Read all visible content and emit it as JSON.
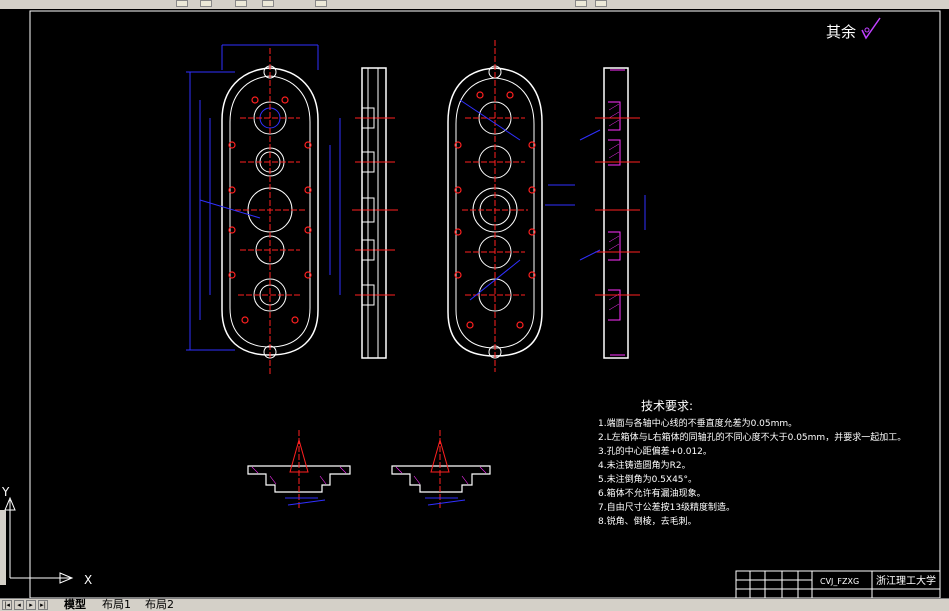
{
  "toolbar": {
    "buttons": [
      "layer-icon",
      "color-icon",
      "linetype-icon",
      "lineweight-icon",
      "plot-icon"
    ]
  },
  "drawing": {
    "roughness_label": "其余",
    "requirements_title": "技术要求:",
    "requirements": [
      "1.端面与各轴中心线的不垂直度允差为0.05mm。",
      "2.L左箱体与L右箱体的同轴孔的不同心度不大于0.05mm，并要求一起加工。",
      "3.孔的中心距偏差+0.012。",
      "4.未注铸造圆角为R2。",
      "5.未注倒角为0.5X45°。",
      "6.箱体不允许有漏油现象。",
      "7.自由尺寸公差按13级精度制造。",
      "8.锐角、倒棱，去毛刺。"
    ],
    "title_block": {
      "drawing_code": "CVJ_FZXG",
      "school": "浙江理工大学"
    }
  },
  "ucs": {
    "x_label": "X",
    "y_label": "Y"
  },
  "tabs": [
    {
      "label": "模型",
      "active": true
    },
    {
      "label": "布局1",
      "active": false
    },
    {
      "label": "布局2",
      "active": false
    }
  ],
  "colors": {
    "outline": "#ffffff",
    "centerline": "#ff2020",
    "dimension": "#3030ff",
    "hatch": "#ff30ff",
    "accent": "#c040ff",
    "canvas": "#000000",
    "chrome": "#d4d0c8"
  }
}
